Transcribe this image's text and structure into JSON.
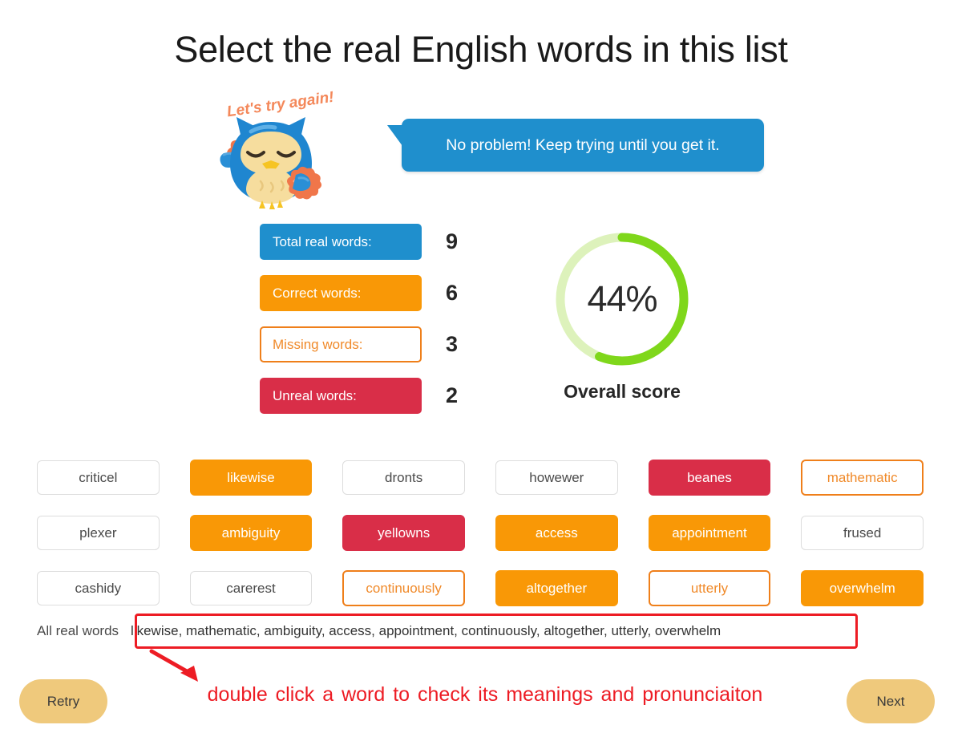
{
  "page_title": "Select the real English words in this list",
  "mascot": {
    "caption": "Let's try again!",
    "icon": "owl-cheerleader-icon"
  },
  "feedback": {
    "message": "No problem! Keep trying until you get it."
  },
  "stats": {
    "rows": [
      {
        "label": "Total real words:",
        "value": "9",
        "style": "blue"
      },
      {
        "label": "Correct words:",
        "value": "6",
        "style": "orange"
      },
      {
        "label": "Missing words:",
        "value": "3",
        "style": "hollow"
      },
      {
        "label": "Unreal words:",
        "value": "2",
        "style": "red"
      }
    ]
  },
  "score": {
    "percent_text": "44%",
    "percent_value": 44,
    "arc_fraction": 0.56,
    "label": "Overall score",
    "track_color": "#ddf2bb",
    "arc_color": "#7fd71b"
  },
  "colors": {
    "blue": "#1f8fcd",
    "orange": "#f99806",
    "missing_border": "#ef7f1a",
    "missing_text": "#f08a2a",
    "red": "#d92e48",
    "neutral_border": "#dddddd",
    "annotation_red": "#ed1c24",
    "button_tan": "#efc97c"
  },
  "word_grid": {
    "rows": [
      [
        {
          "word": "criticel",
          "state": "neutral"
        },
        {
          "word": "likewise",
          "state": "correct"
        },
        {
          "word": "dronts",
          "state": "neutral"
        },
        {
          "word": "howewer",
          "state": "neutral"
        },
        {
          "word": "beanes",
          "state": "unreal"
        },
        {
          "word": "mathematic",
          "state": "missing"
        }
      ],
      [
        {
          "word": "plexer",
          "state": "neutral"
        },
        {
          "word": "ambiguity",
          "state": "correct"
        },
        {
          "word": "yellowns",
          "state": "unreal"
        },
        {
          "word": "access",
          "state": "correct"
        },
        {
          "word": "appointment",
          "state": "correct"
        },
        {
          "word": "frused",
          "state": "neutral"
        }
      ],
      [
        {
          "word": "cashidy",
          "state": "neutral"
        },
        {
          "word": "carerest",
          "state": "neutral"
        },
        {
          "word": "continuously",
          "state": "missing"
        },
        {
          "word": "altogether",
          "state": "correct"
        },
        {
          "word": "utterly",
          "state": "missing"
        },
        {
          "word": "overwhelm",
          "state": "correct"
        }
      ]
    ]
  },
  "all_real_words": {
    "label": "All real words",
    "value": "likewise, mathematic, ambiguity, access, appointment, continuously, altogether, utterly, overwhelm"
  },
  "annotation": {
    "text": "double click a word to check its meanings and pronunciaiton"
  },
  "footer": {
    "retry_label": "Retry",
    "next_label": "Next"
  }
}
